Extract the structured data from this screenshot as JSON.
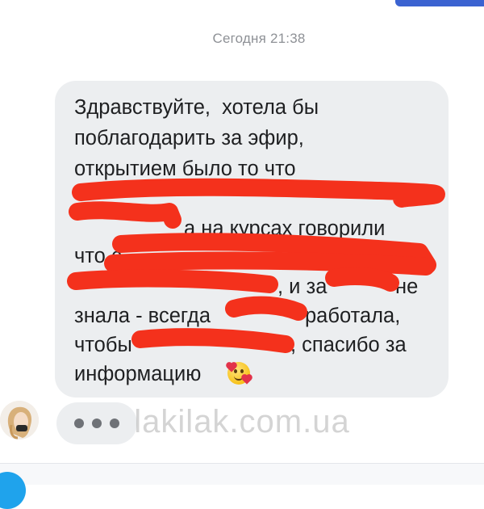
{
  "timestamp": "Сегодня 21:38",
  "message": {
    "lines": [
      "Здравствуйте,  хотела бы",
      "поблагодарить за эфир,",
      "открытием было то что",
      "а на курсах говорили",
      "что с",
      ", и за",
      "не",
      "знала - всегда",
      "работала,",
      "чтобы",
      ", спасибо за",
      "информацию"
    ],
    "emoji": "smiling-face-with-hearts"
  },
  "typing_indicator": {
    "dots": 3
  },
  "watermark": "lakilak.com.ua",
  "colors": {
    "bubble": "#eceef0",
    "redaction": "#f4311c",
    "accent": "#1fa3ec",
    "top_accent": "#3b63d1"
  }
}
